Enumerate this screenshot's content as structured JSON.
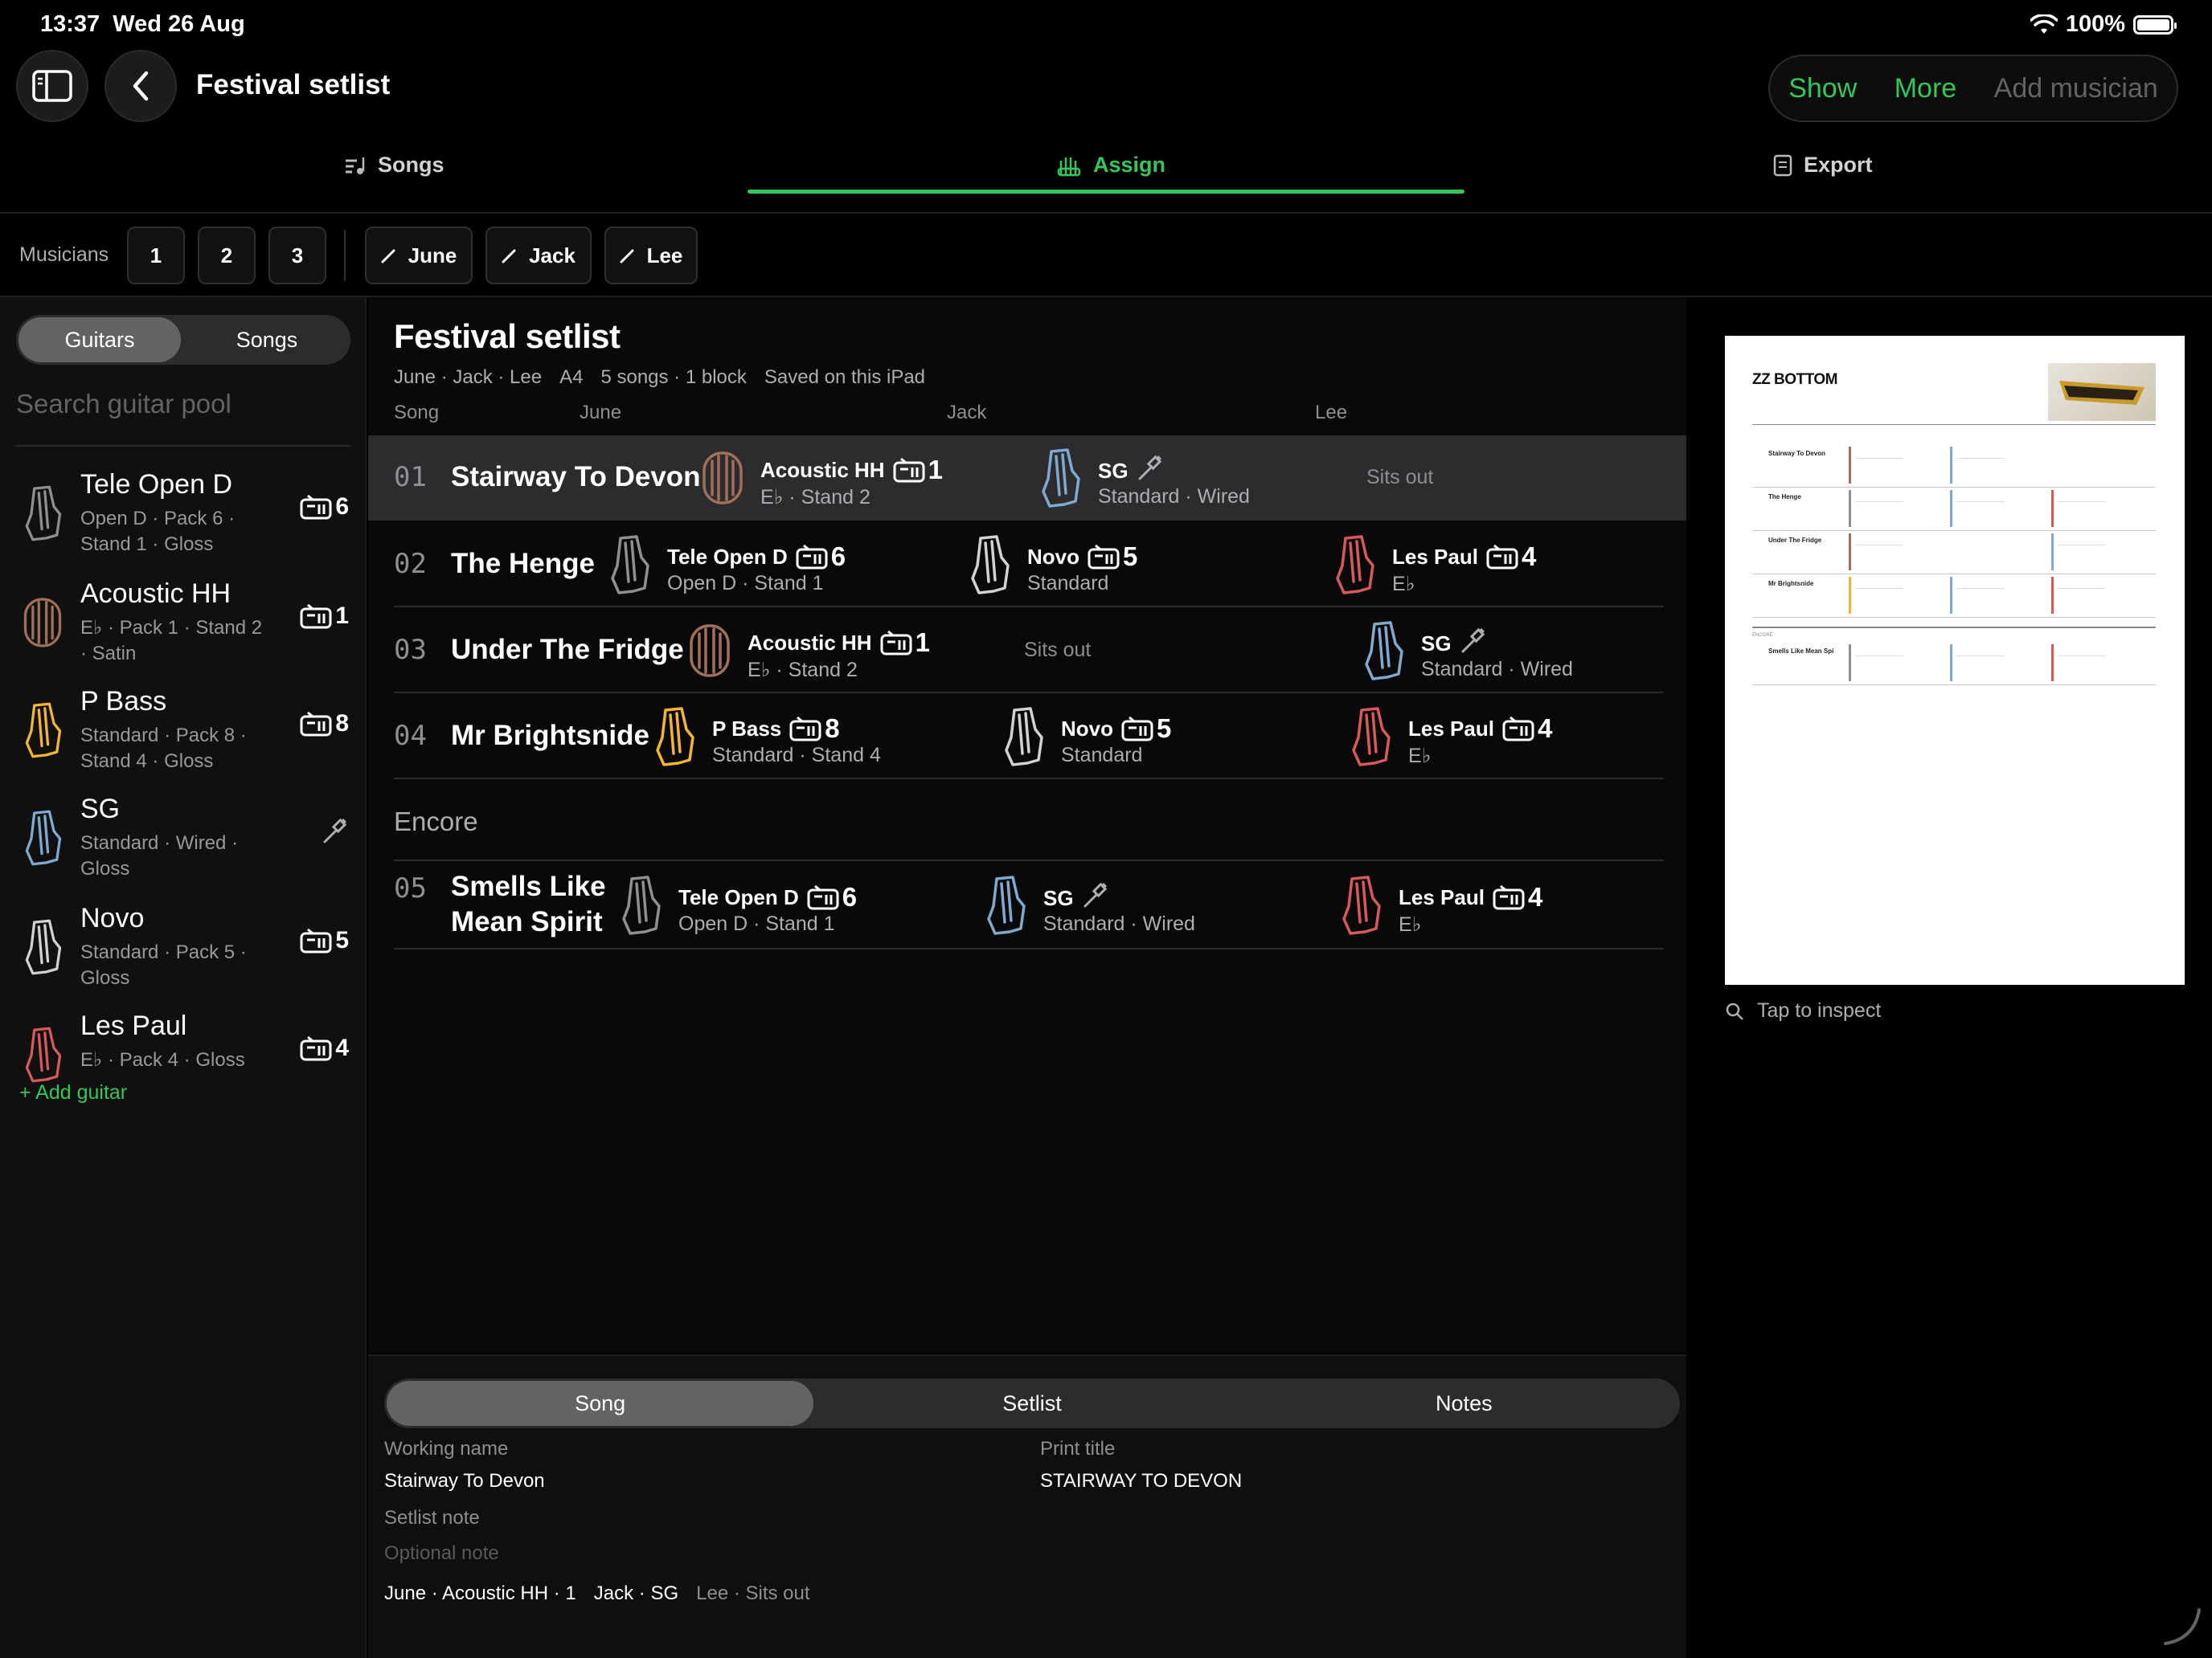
{
  "status": {
    "time": "13:37",
    "date": "Wed 26 Aug",
    "battery": "100%"
  },
  "nav": {
    "title": "Festival setlist",
    "show": "Show",
    "more": "More",
    "add_musician": "Add musician"
  },
  "tabs": {
    "songs": "Songs",
    "assign": "Assign",
    "export": "Export"
  },
  "musicians": {
    "label": "Musicians",
    "counts": [
      "1",
      "2",
      "3"
    ],
    "names": [
      "June",
      "Jack",
      "Lee"
    ]
  },
  "sidebar": {
    "seg_guitars": "Guitars",
    "seg_songs": "Songs",
    "search_placeholder": "Search guitar pool",
    "add_guitar": "+ Add guitar",
    "items": [
      {
        "name": "Tele Open D",
        "sub": "Open D · Pack 6 · Stand 1 · Gloss",
        "badge": "6",
        "color": "#8e8e93"
      },
      {
        "name": "Acoustic HH",
        "sub": "E♭ · Pack 1 · Stand 2 · Satin",
        "badge": "1",
        "color": "#a0705a"
      },
      {
        "name": "P Bass",
        "sub": "Standard · Pack 8 · Stand 4 · Gloss",
        "badge": "8",
        "color": "#f2b632"
      },
      {
        "name": "SG",
        "sub": "Standard · Wired · Gloss",
        "badge": "",
        "color": "#7fa9cf"
      },
      {
        "name": "Novo",
        "sub": "Standard · Pack 5 · Gloss",
        "badge": "5",
        "color": "#d1d1d6"
      },
      {
        "name": "Les Paul",
        "sub": "E♭ · Pack 4 · Gloss",
        "badge": "4",
        "color": "#d65a5a"
      }
    ]
  },
  "main": {
    "title": "Festival setlist",
    "meta": [
      "June · Jack · Lee",
      "A4",
      "5 songs · 1 block",
      "Saved on this iPad"
    ],
    "col_song": "Song",
    "col_june": "June",
    "col_jack": "Jack",
    "col_lee": "Lee",
    "encore": "Encore",
    "sits_out": "Sits out",
    "songs": [
      {
        "num": "01",
        "title": "Stairway To Devon"
      },
      {
        "num": "02",
        "title": "The Henge"
      },
      {
        "num": "03",
        "title": "Under The Fridge"
      },
      {
        "num": "04",
        "title": "Mr Brightsnide"
      },
      {
        "num": "05",
        "title": "Smells Like Mean Spirit"
      }
    ],
    "assign": {
      "acoustic": {
        "name": "Acoustic HH",
        "sub": "E♭ · Stand 2",
        "amp": "1"
      },
      "sg": {
        "name": "SG",
        "sub": "Standard · Wired"
      },
      "tele": {
        "name": "Tele Open D",
        "sub": "Open D · Stand 1",
        "amp": "6"
      },
      "novo": {
        "name": "Novo",
        "sub": "Standard",
        "amp": "5"
      },
      "lespaul": {
        "name": "Les Paul",
        "sub": "E♭",
        "amp": "4"
      },
      "pbass": {
        "name": "P Bass",
        "sub": "Standard · Stand 4",
        "amp": "8"
      }
    }
  },
  "detail": {
    "seg_song": "Song",
    "seg_setlist": "Setlist",
    "seg_notes": "Notes",
    "working_name_label": "Working name",
    "working_name": "Stairway To Devon",
    "print_title_label": "Print title",
    "print_title": "STAIRWAY TO DEVON",
    "setlist_note_label": "Setlist note",
    "optional_note_placeholder": "Optional note",
    "summary_june": "June · Acoustic HH · 1",
    "summary_jack": "Jack · SG",
    "summary_lee": "Lee · Sits out"
  },
  "preview": {
    "band": "ZZ BOTTOM",
    "songs": [
      "Stairway To Devon",
      "The Henge",
      "Under The Fridge",
      "Mr Brightsnide",
      "Smells Like Mean Spi"
    ],
    "encore": "ENCORE",
    "inspect": "Tap to inspect"
  }
}
